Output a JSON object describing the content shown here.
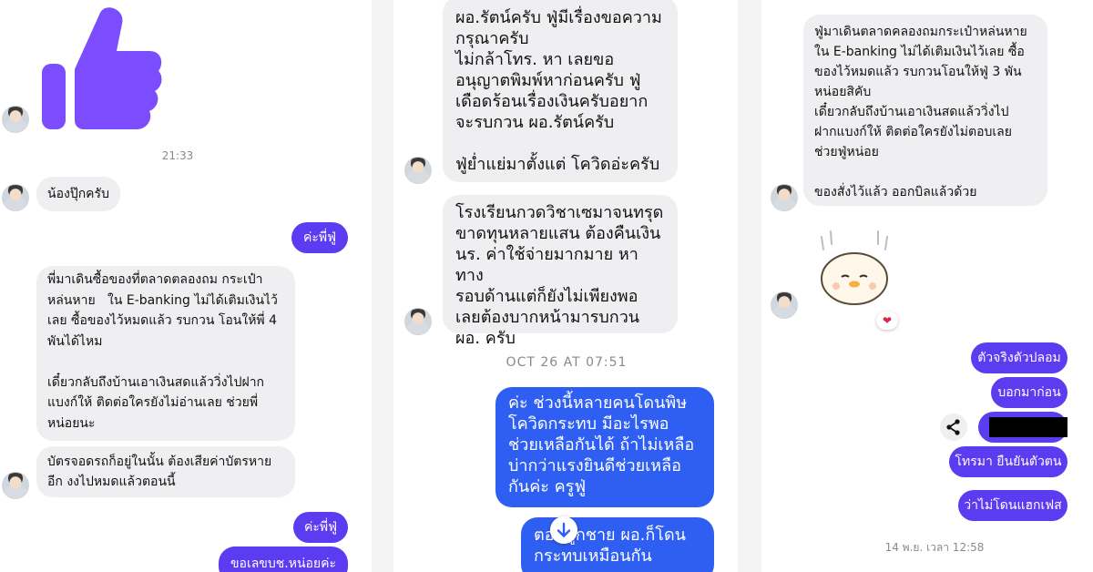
{
  "panel1": {
    "time_label": "21:33",
    "messages": [
      {
        "dir": "in",
        "text": "น้องปุ๊กครับ"
      },
      {
        "dir": "out",
        "text": "ค่ะพี่ฟู่"
      },
      {
        "dir": "in",
        "text": "พี่มาเดินซื้อของที่ตลาดตลองถม กระเป๋า\nหล่นหาย   ใน E-banking ไม่ได้เติมเงินไว้\nเลย ซื้อของไว้หมดแล้ว รบกวน โอนให้พี่ 4\nพันได้ไหม\n\nเดี๋ยวกลับถึงบ้านเอาเงินสดแล้ววิ่งไปฝาก\nแบงก์ให้ ติดต่อใครยังไม่อ่านเลย ช่วยพี่\nหน่อยนะ"
      },
      {
        "dir": "in",
        "text": "บัตรจอดรถก็อยู่ในนั้น ต้องเสียค่าบัตรหาย\nอีก งงไปหมดแล้วตอนนี้"
      },
      {
        "dir": "out",
        "text": "ค่ะพี่ฟู่"
      },
      {
        "dir": "out",
        "text": "ขอเลขบช.หน่อยค่ะ"
      }
    ]
  },
  "panel2": {
    "time_label": "OCT 26 AT 07:51",
    "messages": [
      {
        "dir": "in",
        "text": "ผอ.รัตน์ครับ ฟู่มีเรื่องขอความ\nกรุณาครับ\nไม่กล้าโทร. หา เลยขอ\nอนุญาตพิมพ์หาก่อนครับ ฟู่\nเดือดร้อนเรื่องเงินครับอยาก\nจะรบกวน ผอ.รัตน์ครับ\n\nฟู่ย่ำแย่มาตั้งแต่ โควิดอ่ะครับ"
      },
      {
        "dir": "in",
        "text": "โรงเรียนกวดวิชาเซมาจนทรุด\nขาดทุนหลายแสน ต้องคืนเงิน\nนร. ค่าใช้จ่ายมากมาย หาทาง\nรอบด้านแต่ก็ยังไม่เพียงพอ\nเลยต้องบากหน้ามารบกวน\nผอ. ครับ"
      },
      {
        "dir": "out",
        "text": "ค่ะ ช่วงนี้หลายคนโดนพิษ\nโควิดกระทบ มีอะไรพอ\nช่วยเหลือกันได้ ถ้าไม่เหลือ\nบ่ากว่าแรงยินดีช่วยเหลือ\nกันค่ะ ครูฟู่"
      },
      {
        "dir": "out",
        "text": "ตอนลูกชาย ผอ.ก็โดน\nกระทบเหมือนกัน"
      }
    ]
  },
  "panel3": {
    "time_label": "14 พ.ย. เวลา 12:58",
    "messages": [
      {
        "dir": "in",
        "text": "ฟู่มาเดินตลาดคลองถมกระเป๋าหล่นหาย\nใน E-banking ไม่ได้เติมเงินไว้เลย ซื้อ\nของไว้หมดแล้ว รบกวนโอนให้ฟู่ 3 พัน\nหน่อยสิคับ\nเดี๋ยวกลับถึงบ้านเอาเงินสดแล้ววิ่งไป\nฝากแบงก์ให้ ติดต่อใครยังไม่ตอบเลย\nช่วยฟู่หน่อย\n\nของสั่งไว้แล้ว ออกบิลแล้วด้วย"
      },
      {
        "dir": "out",
        "text": "ตัวจริงตัวปลอม"
      },
      {
        "dir": "out",
        "text": "บอกมาก่อน"
      },
      {
        "dir": "out",
        "text": "โทรมา ยืนยันตัวตน"
      },
      {
        "dir": "out",
        "text": "ว่าไม่โดนแฮกเฟส"
      }
    ],
    "reaction": "❤"
  },
  "icons": {
    "like": "thumbs-up-icon",
    "share": "share-icon",
    "scroll": "arrow-down-icon",
    "sticker": "chick-sticker-icon"
  },
  "colors": {
    "incoming_bubble": "#efeff1",
    "outgoing_purple": "#5b3cf0",
    "outgoing_blue": "#2f5ff2",
    "like_icon": "#7b4dff"
  }
}
